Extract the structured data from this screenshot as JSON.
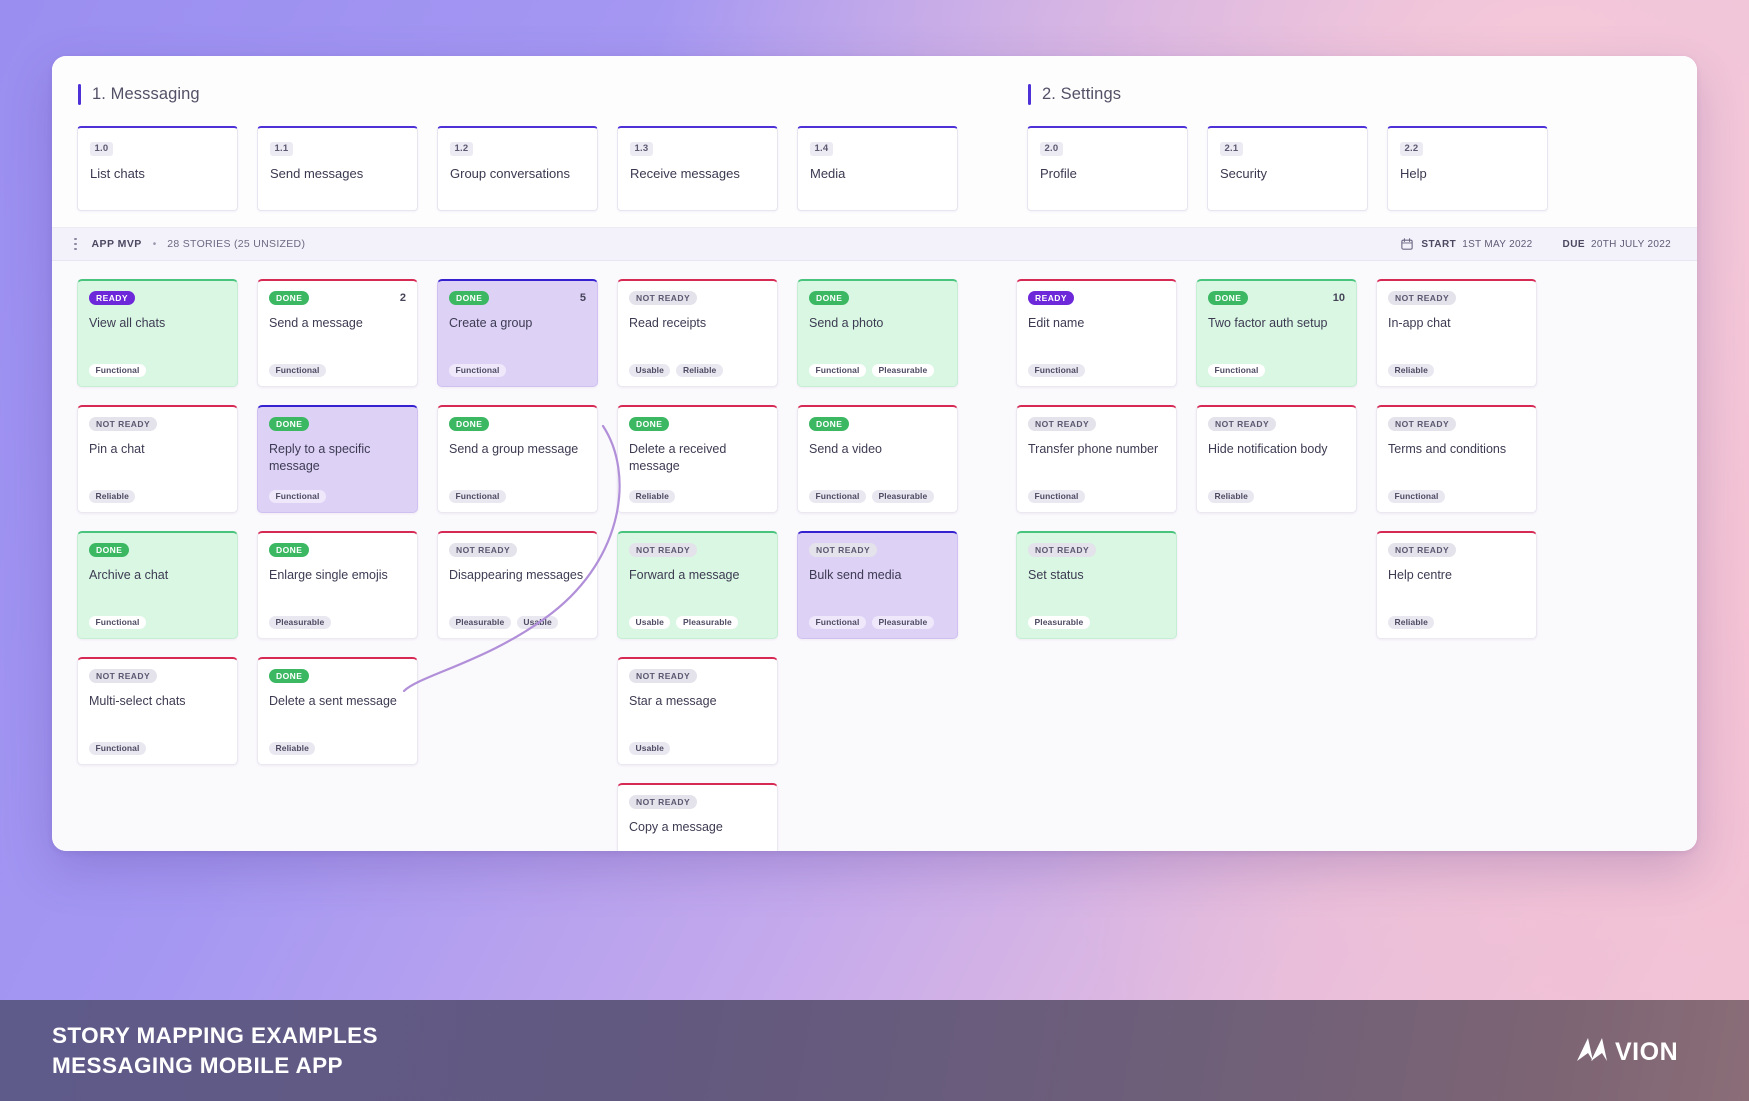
{
  "board": {
    "sections": [
      {
        "title": "1. Messsaging",
        "activities": [
          {
            "ref": "1.0",
            "name": "List chats"
          },
          {
            "ref": "1.1",
            "name": "Send messages"
          },
          {
            "ref": "1.2",
            "name": "Group conversations"
          },
          {
            "ref": "1.3",
            "name": "Receive messages"
          },
          {
            "ref": "1.4",
            "name": "Media"
          }
        ]
      },
      {
        "title": "2. Settings",
        "activities": [
          {
            "ref": "2.0",
            "name": "Profile"
          },
          {
            "ref": "2.1",
            "name": "Security"
          },
          {
            "ref": "2.2",
            "name": "Help"
          }
        ]
      }
    ]
  },
  "release": {
    "menu_icon": "kebab-menu-icon",
    "name": "APP MVP",
    "separator": "•",
    "stories": "28 STORIES (25 UNSIZED)",
    "calendar_icon": "calendar-icon",
    "start_label": "START",
    "start_value": "1ST MAY 2022",
    "due_label": "DUE",
    "due_value": "20TH JULY 2022"
  },
  "columns": [
    {
      "group": "left",
      "activity_ref": "1.0",
      "cards": [
        {
          "status": "READY",
          "status_kind": "ready",
          "title": "View all chats",
          "points": "",
          "tags": [
            "Functional"
          ],
          "fill": "green",
          "accent": "green"
        },
        {
          "status": "NOT READY",
          "status_kind": "notready",
          "title": "Pin a chat",
          "points": "",
          "tags": [
            "Reliable"
          ],
          "fill": "white",
          "accent": "red"
        },
        {
          "status": "DONE",
          "status_kind": "done",
          "title": "Archive a chat",
          "points": "",
          "tags": [
            "Functional"
          ],
          "fill": "green",
          "accent": "green"
        },
        {
          "status": "NOT READY",
          "status_kind": "notready",
          "title": "Multi-select chats",
          "points": "",
          "tags": [
            "Functional"
          ],
          "fill": "white",
          "accent": "red"
        }
      ]
    },
    {
      "group": "left",
      "activity_ref": "1.1",
      "cards": [
        {
          "status": "DONE",
          "status_kind": "done",
          "title": "Send a message",
          "points": "2",
          "tags": [
            "Functional"
          ],
          "fill": "white",
          "accent": "red"
        },
        {
          "status": "DONE",
          "status_kind": "done",
          "title": "Reply to a specific message",
          "points": "",
          "tags": [
            "Functional"
          ],
          "fill": "purple",
          "accent": "indigo"
        },
        {
          "status": "DONE",
          "status_kind": "done",
          "title": "Enlarge single emojis",
          "points": "",
          "tags": [
            "Pleasurable"
          ],
          "fill": "white",
          "accent": "red"
        },
        {
          "status": "DONE",
          "status_kind": "done",
          "title": "Delete a sent message",
          "points": "",
          "tags": [
            "Reliable"
          ],
          "fill": "white",
          "accent": "red"
        }
      ]
    },
    {
      "group": "left",
      "activity_ref": "1.2",
      "cards": [
        {
          "status": "DONE",
          "status_kind": "done",
          "title": "Create a group",
          "points": "5",
          "tags": [
            "Functional"
          ],
          "fill": "purple",
          "accent": "indigo"
        },
        {
          "status": "DONE",
          "status_kind": "done",
          "title": "Send a group message",
          "points": "",
          "tags": [
            "Functional"
          ],
          "fill": "white",
          "accent": "red"
        },
        {
          "status": "NOT READY",
          "status_kind": "notready",
          "title": "Disappearing messages",
          "points": "",
          "tags": [
            "Pleasurable",
            "Usable"
          ],
          "fill": "white",
          "accent": "red"
        }
      ]
    },
    {
      "group": "left",
      "activity_ref": "1.3",
      "cards": [
        {
          "status": "NOT READY",
          "status_kind": "notready",
          "title": "Read receipts",
          "points": "",
          "tags": [
            "Usable",
            "Reliable"
          ],
          "fill": "white",
          "accent": "red"
        },
        {
          "status": "DONE",
          "status_kind": "done",
          "title": "Delete a received message",
          "points": "",
          "tags": [
            "Reliable"
          ],
          "fill": "white",
          "accent": "red"
        },
        {
          "status": "NOT READY",
          "status_kind": "notready",
          "title": "Forward a message",
          "points": "",
          "tags": [
            "Usable",
            "Pleasurable"
          ],
          "fill": "green",
          "accent": "green"
        },
        {
          "status": "NOT READY",
          "status_kind": "notready",
          "title": "Star a message",
          "points": "",
          "tags": [
            "Usable"
          ],
          "fill": "white",
          "accent": "red"
        },
        {
          "status": "NOT READY",
          "status_kind": "notready",
          "title": "Copy a message",
          "points": "",
          "tags": [],
          "fill": "white",
          "accent": "red"
        }
      ]
    },
    {
      "group": "left",
      "activity_ref": "1.4",
      "cards": [
        {
          "status": "DONE",
          "status_kind": "done",
          "title": "Send a photo",
          "points": "",
          "tags": [
            "Functional",
            "Pleasurable"
          ],
          "fill": "green",
          "accent": "green"
        },
        {
          "status": "DONE",
          "status_kind": "done",
          "title": "Send a video",
          "points": "",
          "tags": [
            "Functional",
            "Pleasurable"
          ],
          "fill": "white",
          "accent": "red"
        },
        {
          "status": "NOT READY",
          "status_kind": "notready",
          "title": "Bulk send media",
          "points": "",
          "tags": [
            "Functional",
            "Pleasurable"
          ],
          "fill": "purple",
          "accent": "indigo"
        }
      ]
    },
    {
      "group": "right",
      "activity_ref": "2.0",
      "cards": [
        {
          "status": "READY",
          "status_kind": "ready",
          "title": "Edit name",
          "points": "",
          "tags": [
            "Functional"
          ],
          "fill": "white",
          "accent": "red"
        },
        {
          "status": "NOT READY",
          "status_kind": "notready",
          "title": "Transfer phone number",
          "points": "",
          "tags": [
            "Functional"
          ],
          "fill": "white",
          "accent": "red"
        },
        {
          "status": "NOT READY",
          "status_kind": "notready",
          "title": "Set status",
          "points": "",
          "tags": [
            "Pleasurable"
          ],
          "fill": "green",
          "accent": "green"
        }
      ]
    },
    {
      "group": "right",
      "activity_ref": "2.1",
      "cards": [
        {
          "status": "DONE",
          "status_kind": "done",
          "title": "Two factor auth setup",
          "points": "10",
          "tags": [
            "Functional"
          ],
          "fill": "green",
          "accent": "green"
        },
        {
          "status": "NOT READY",
          "status_kind": "notready",
          "title": "Hide notification body",
          "points": "",
          "tags": [
            "Reliable"
          ],
          "fill": "white",
          "accent": "red"
        }
      ]
    },
    {
      "group": "right",
      "activity_ref": "2.2",
      "cards": [
        {
          "status": "NOT READY",
          "status_kind": "notready",
          "title": "In-app chat",
          "points": "",
          "tags": [
            "Reliable"
          ],
          "fill": "white",
          "accent": "red"
        },
        {
          "status": "NOT READY",
          "status_kind": "notready",
          "title": "Terms and conditions",
          "points": "",
          "tags": [
            "Functional"
          ],
          "fill": "white",
          "accent": "red"
        },
        {
          "status": "NOT READY",
          "status_kind": "notready",
          "title": "Help centre",
          "points": "",
          "tags": [
            "Reliable"
          ],
          "fill": "white",
          "accent": "red"
        }
      ]
    }
  ],
  "footer": {
    "line1": "STORY MAPPING EXAMPLES",
    "line2": "MESSAGING MOBILE APP",
    "brand": "VION",
    "brand_full": "AVION",
    "logo_icon": "avion-logo-icon"
  },
  "colors": {
    "accent_indigo": "#4f31d8",
    "status_ready": "#6d28d9",
    "status_done": "#3cb863",
    "status_notready": "#e4e2ea",
    "border_green": "#49c47d",
    "border_red": "#d62a55",
    "border_indigo": "#3521cf",
    "card_green": "#d9f7e3",
    "card_purple": "#ddd1f6",
    "connector": "#b18fd9"
  }
}
